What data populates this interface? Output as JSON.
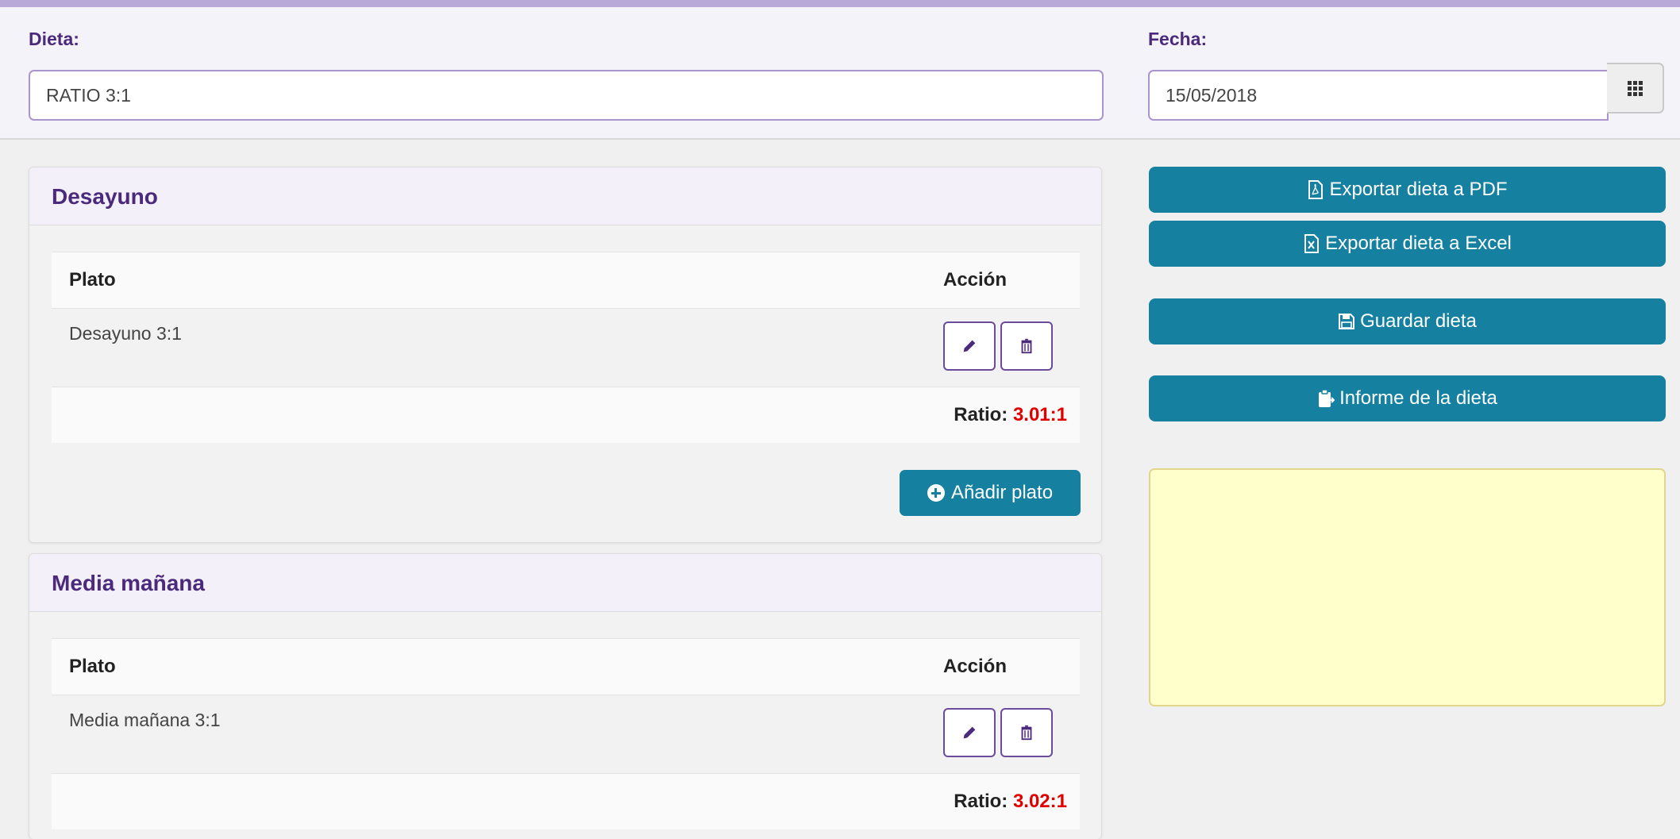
{
  "header": {
    "dieta_label": "Dieta:",
    "dieta_value": "RATIO 3:1",
    "fecha_label": "Fecha:",
    "fecha_value": "15/05/2018"
  },
  "meals": [
    {
      "title": "Desayuno",
      "col_plato": "Plato",
      "col_accion": "Acción",
      "rows": [
        {
          "name": "Desayuno 3:1"
        }
      ],
      "ratio_label": "Ratio:",
      "ratio_value": "3.01:1",
      "add_label": "Añadir plato"
    },
    {
      "title": "Media mañana",
      "col_plato": "Plato",
      "col_accion": "Acción",
      "rows": [
        {
          "name": "Media mañana 3:1"
        }
      ],
      "ratio_label": "Ratio:",
      "ratio_value": "3.02:1"
    }
  ],
  "actions": {
    "export_pdf": "Exportar dieta a PDF",
    "export_excel": "Exportar dieta a Excel",
    "save": "Guardar dieta",
    "report": "Informe de la dieta"
  },
  "colors": {
    "accent_purple": "#4b2a7b",
    "button_teal": "#15809f",
    "ratio_red": "#e00000",
    "note_yellow": "#ffffcc"
  },
  "icons": [
    "calendar-grid-icon",
    "pencil-icon",
    "trash-icon",
    "plus-circle-icon",
    "pdf-file-icon",
    "excel-file-icon",
    "floppy-disk-icon",
    "clipboard-icon"
  ]
}
